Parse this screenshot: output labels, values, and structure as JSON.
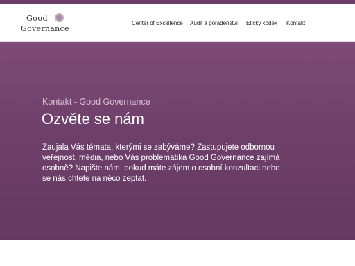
{
  "brand": {
    "logo_line1": "Good",
    "logo_line2": "Governance"
  },
  "nav": {
    "items": [
      {
        "label": "Center of Excellence"
      },
      {
        "label": "Audit a poradenství"
      },
      {
        "label": "Etický kodex"
      },
      {
        "label": "Kontakt"
      }
    ]
  },
  "hero": {
    "breadcrumb": "Kontakt - Good Governance",
    "title": "Ozvěte se nám",
    "intro_lines": [
      "Zaujala Vás témata, kterými se zabýváme? Zastupujete odbornou",
      "veřejnost, média, nebo Vás problematika Good Governance zajímá",
      "osobně? Napište nám, pokud máte zájem o osobní konzultaci nebo",
      "se nás chtete na něco zeptat."
    ]
  },
  "colors": {
    "brand_purple": "#6e3d6a",
    "hero_top": "#7e4b79",
    "hero_bottom": "#633961",
    "breadcrumb_text": "#d7c2d5"
  }
}
